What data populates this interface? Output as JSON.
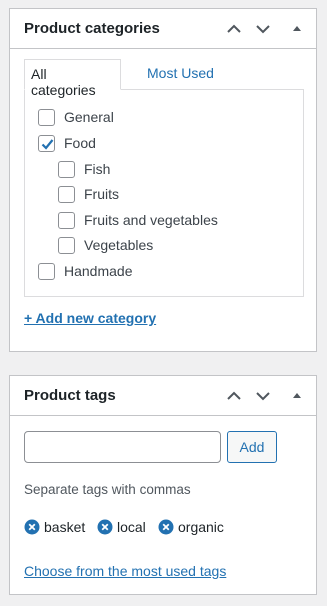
{
  "categories_box": {
    "title": "Product categories",
    "tabs": {
      "all": "All categories",
      "most_used": "Most Used"
    },
    "items": [
      {
        "label": "General",
        "checked": false
      },
      {
        "label": "Food",
        "checked": true
      },
      {
        "label": "Fish",
        "checked": false
      },
      {
        "label": "Fruits",
        "checked": false
      },
      {
        "label": "Fruits and vegetables",
        "checked": false
      },
      {
        "label": "Vegetables",
        "checked": false
      },
      {
        "label": "Handmade",
        "checked": false
      }
    ],
    "add_new": "+ Add new category"
  },
  "tags_box": {
    "title": "Product tags",
    "input_value": "",
    "add_button": "Add",
    "hint": "Separate tags with commas",
    "tags": [
      "basket",
      "local",
      "organic"
    ],
    "most_used_link": "Choose from the most used tags"
  },
  "colors": {
    "accent": "#2271b1",
    "border": "#c3c4c7",
    "background": "#f0f0f1"
  },
  "icons": {
    "move_up": "chevron-up-icon",
    "move_down": "chevron-down-icon",
    "toggle": "triangle-up-icon",
    "remove_tag": "remove-circle-icon",
    "checked": "checkmark-icon"
  }
}
